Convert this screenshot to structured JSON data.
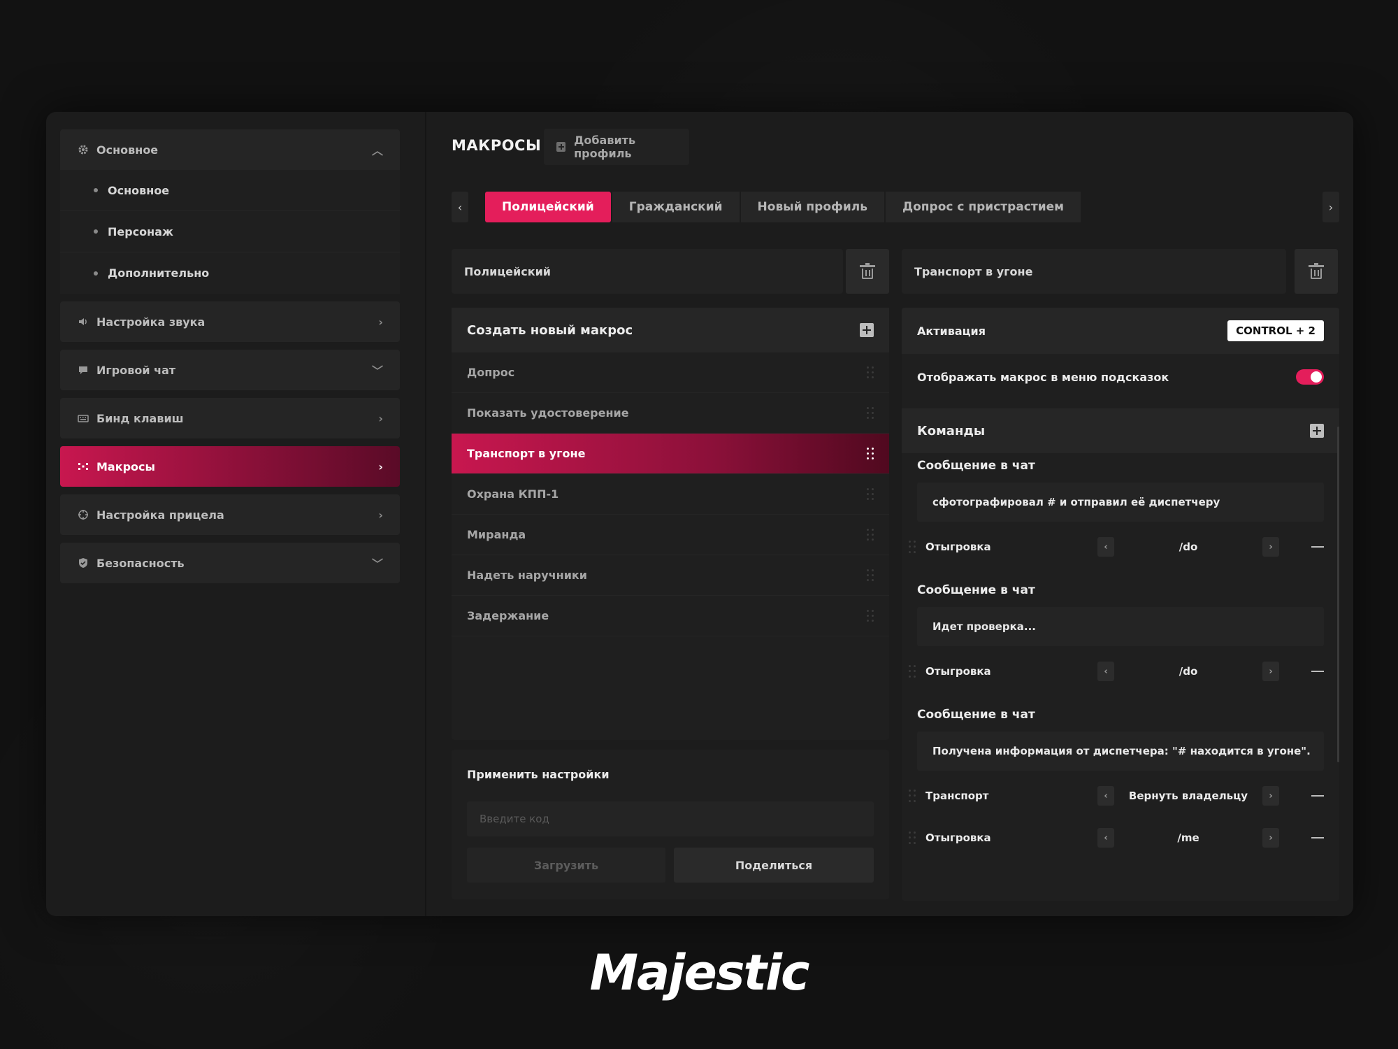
{
  "header": {
    "title": "МАКРОСЫ",
    "add_profile": "Добавить профиль"
  },
  "sidebar": {
    "sections": [
      {
        "label": "Основное",
        "icon": "gear-icon",
        "expanded": true,
        "items": [
          "Основное",
          "Персонаж",
          "Дополнительно"
        ]
      },
      {
        "label": "Настройка звука",
        "icon": "speaker-icon"
      },
      {
        "label": "Игровой чат",
        "icon": "chat-icon"
      },
      {
        "label": "Бинд клавиш",
        "icon": "keyboard-icon"
      },
      {
        "label": "Макросы",
        "icon": "macro-icon",
        "active": true
      },
      {
        "label": "Настройка прицела",
        "icon": "crosshair-icon"
      },
      {
        "label": "Безопасность",
        "icon": "shield-icon"
      }
    ]
  },
  "tabs": [
    "Полицейский",
    "Гражданский",
    "Новый профиль",
    "Допрос с пристрастием"
  ],
  "active_tab": 0,
  "profile": {
    "name": "Полицейский"
  },
  "macros": {
    "create_label": "Создать новый макрос",
    "items": [
      "Допрос",
      "Показать удостоверение",
      "Транспорт в угоне",
      "Охрана КПП-1",
      "Миранда",
      "Надеть наручники",
      "Задержание"
    ],
    "active": 2
  },
  "apply": {
    "title": "Применить настройки",
    "placeholder": "Введите код",
    "load": "Загрузить",
    "share": "Поделиться"
  },
  "detail": {
    "name": "Транспорт в угоне",
    "activation_label": "Активация",
    "hotkey": "CONTROL + 2",
    "show_hint_label": "Отображать макрос в меню подсказок",
    "show_hint": true,
    "commands_label": "Команды",
    "commands": [
      {
        "type": "chat",
        "label": "Сообщение в чат",
        "text": "сфотографировал # и отправил её диспетчеру"
      },
      {
        "type": "select",
        "label": "Отыгровка",
        "value": "/do"
      },
      {
        "type": "chat",
        "label": "Сообщение в чат",
        "text": "Идет проверка..."
      },
      {
        "type": "select",
        "label": "Отыгровка",
        "value": "/do"
      },
      {
        "type": "chat",
        "label": "Сообщение в чат",
        "text": "Получена информация от диспетчера: \"# находится в угоне\"."
      },
      {
        "type": "select",
        "label": "Транспорт",
        "value": "Вернуть владельцу"
      },
      {
        "type": "select",
        "label": "Отыгровка",
        "value": "/me"
      }
    ]
  },
  "brand": {
    "logo": "Majestic"
  },
  "colors": {
    "accent": "#e41e5b",
    "background": "#121212",
    "panel": "#1f1f1f"
  }
}
